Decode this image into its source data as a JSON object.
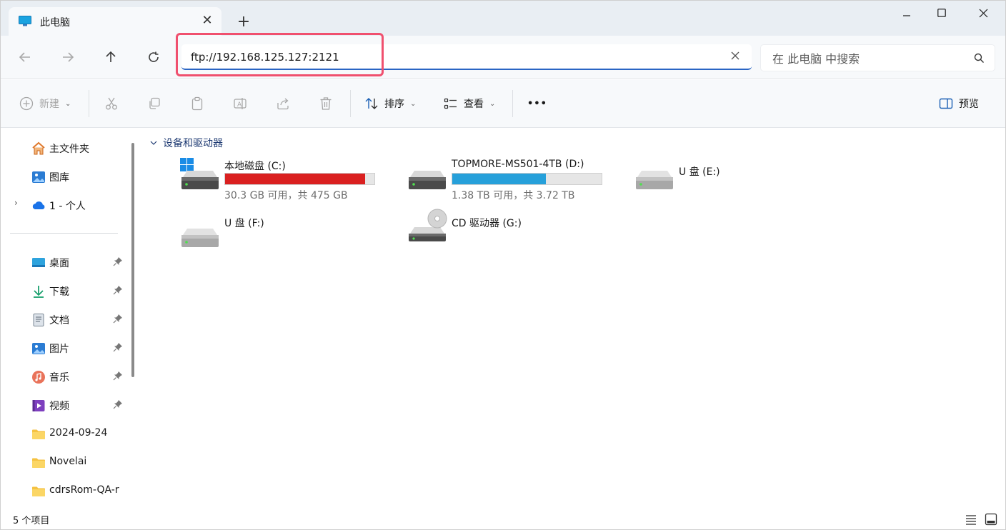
{
  "window": {
    "tab_title": "此电脑",
    "new_tab": "+"
  },
  "nav": {
    "address_value": "ftp://192.168.125.127:2121",
    "search_placeholder": "在 此电脑 中搜索"
  },
  "toolbar": {
    "new_label": "新建",
    "sort_label": "排序",
    "view_label": "查看",
    "more_label": "•••",
    "preview_label": "预览"
  },
  "sidebar": {
    "items": [
      {
        "label": "主文件夹",
        "icon": "home-icon"
      },
      {
        "label": "图库",
        "icon": "gallery-icon"
      },
      {
        "label": "1 - 个人",
        "icon": "onedrive-cloud-icon"
      }
    ],
    "quick_access": [
      {
        "label": "桌面",
        "icon": "desktop-icon",
        "pinned": true
      },
      {
        "label": "下载",
        "icon": "download-icon",
        "pinned": true
      },
      {
        "label": "文档",
        "icon": "document-icon",
        "pinned": true
      },
      {
        "label": "图片",
        "icon": "pictures-icon",
        "pinned": true
      },
      {
        "label": "音乐",
        "icon": "music-icon",
        "pinned": true
      },
      {
        "label": "视频",
        "icon": "video-icon",
        "pinned": true
      },
      {
        "label": "2024-09-24",
        "icon": "folder-icon",
        "pinned": false
      },
      {
        "label": "Novelai",
        "icon": "folder-icon",
        "pinned": false
      },
      {
        "label": "cdrsRom-QA-r",
        "icon": "folder-icon",
        "pinned": false
      }
    ]
  },
  "main": {
    "group_header": "设备和驱动器",
    "drives": [
      {
        "name": "本地磁盘 (C:)",
        "space": "30.3 GB 可用，共 475 GB",
        "used_fraction": 0.936,
        "bar_color": "#da2020",
        "icon": "windows-drive-icon"
      },
      {
        "name": "TOPMORE-MS501-4TB (D:)",
        "space": "1.38 TB 可用，共 3.72 TB",
        "used_fraction": 0.629,
        "bar_color": "#26a0da",
        "icon": "hard-drive-icon"
      },
      {
        "name": "U 盘 (E:)",
        "space": "",
        "used_fraction": null,
        "bar_color": "",
        "icon": "usb-drive-icon"
      },
      {
        "name": "U 盘 (F:)",
        "space": "",
        "used_fraction": null,
        "bar_color": "",
        "icon": "usb-drive-icon"
      },
      {
        "name": "CD 驱动器 (G:)",
        "space": "",
        "used_fraction": null,
        "bar_color": "",
        "icon": "cd-drive-icon"
      }
    ]
  },
  "status": {
    "item_count": "5 个项目"
  },
  "colors": {
    "accent": "#2a65c4",
    "highlight_box": "#f0506e",
    "drive_c_bar": "#da2020",
    "drive_d_bar": "#26a0da"
  }
}
